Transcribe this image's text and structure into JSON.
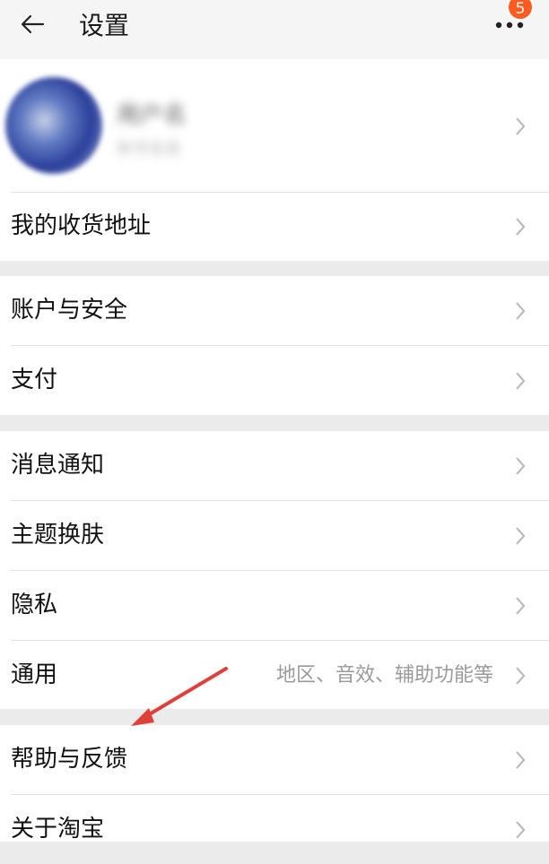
{
  "header": {
    "title": "设置",
    "more_badge_count": "5"
  },
  "profile": {
    "name": "用户名",
    "subtitle": "账号信息"
  },
  "menu": {
    "address": "我的收货地址",
    "account_security": "账户与安全",
    "payment": "支付",
    "notifications": "消息通知",
    "theme": "主题换肤",
    "privacy": "隐私",
    "general": "通用",
    "general_subtitle": "地区、音效、辅助功能等",
    "help_feedback": "帮助与反馈",
    "about": "关于淘宝"
  },
  "colors": {
    "badge": "#ff5a1f",
    "annotation_arrow": "#e0403a",
    "section_gap": "#ebebeb"
  },
  "icons": [
    "back-arrow-icon",
    "more-dots-icon",
    "chevron-right-icon"
  ]
}
